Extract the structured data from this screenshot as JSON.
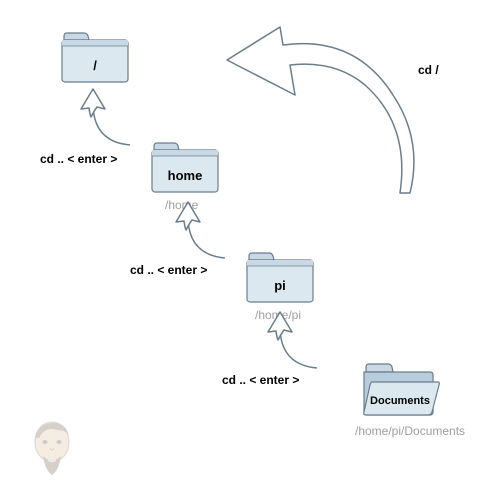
{
  "folders": {
    "root": {
      "label": "/",
      "path": ""
    },
    "home": {
      "label": "home",
      "path": "/home"
    },
    "pi": {
      "label": "pi",
      "path": "/home/pi"
    },
    "documents": {
      "label": "Documents",
      "path": "/home/pi/Documents"
    }
  },
  "commands": {
    "up1": "cd .. < enter >",
    "up2": "cd .. < enter >",
    "up3": "cd .. < enter >",
    "root": "cd /"
  }
}
